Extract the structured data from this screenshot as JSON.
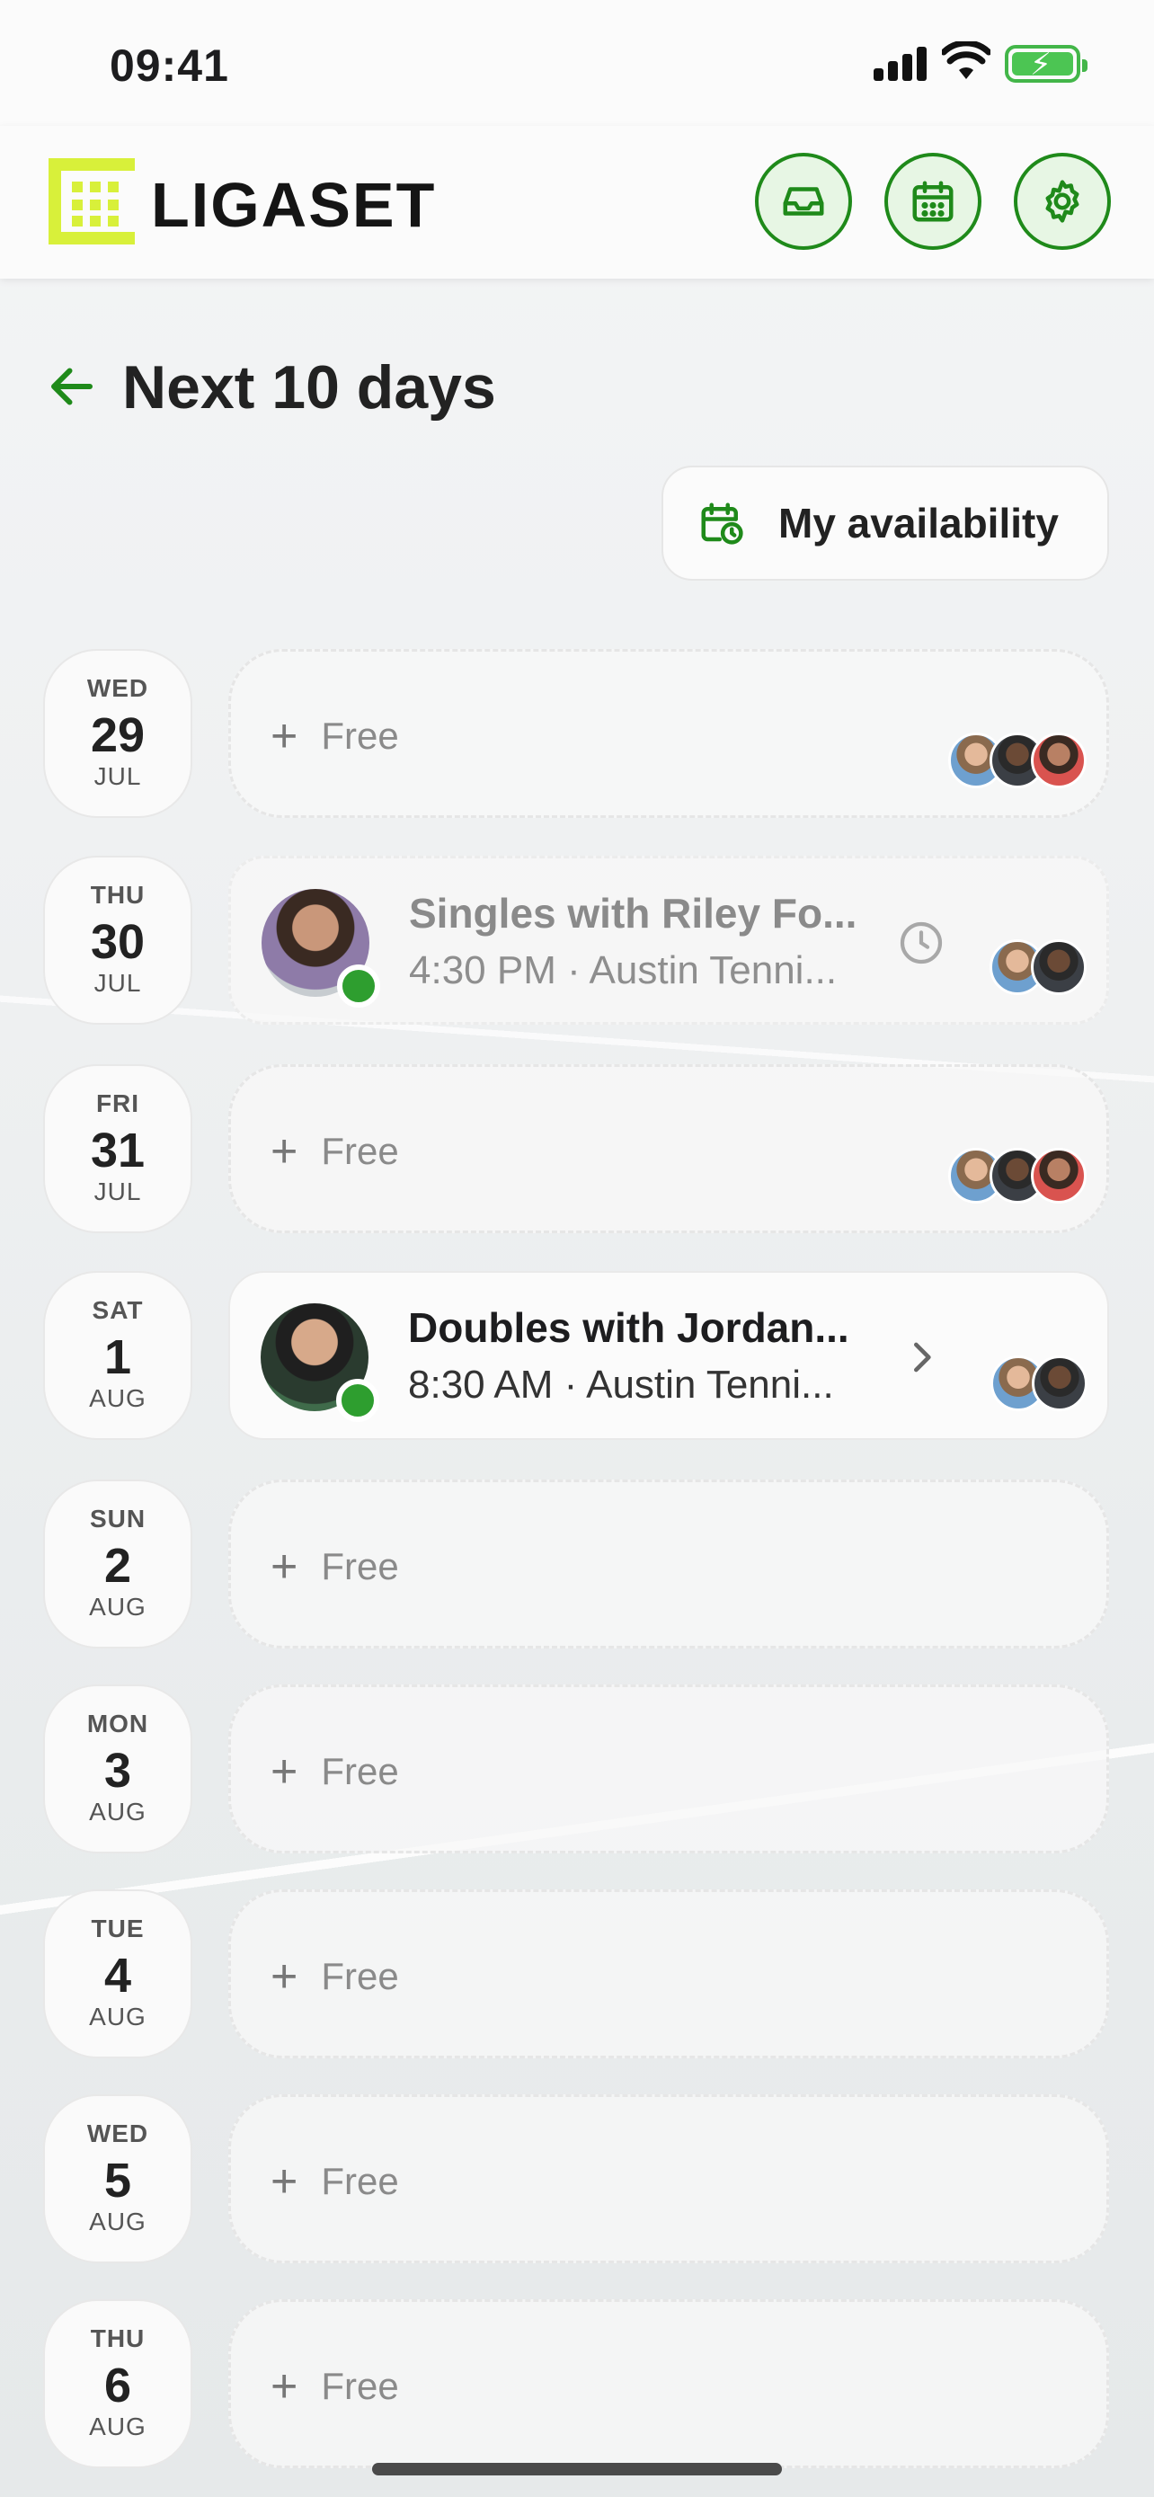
{
  "status_bar": {
    "time": "09:41"
  },
  "header": {
    "brand": "LIGASET"
  },
  "page": {
    "title": "Next 10 days",
    "availability_label": "My availability"
  },
  "days": [
    {
      "dow": "WED",
      "day": "29",
      "month": "JUL",
      "slot": "Free"
    },
    {
      "dow": "THU",
      "day": "30",
      "month": "JUL",
      "match_title": "Singles with Riley Fo...",
      "match_sub": "4:30 PM · Austin Tenni..."
    },
    {
      "dow": "FRI",
      "day": "31",
      "month": "JUL",
      "slot": "Free"
    },
    {
      "dow": "SAT",
      "day": "1",
      "month": "AUG",
      "match_title": "Doubles with Jordan...",
      "match_sub": "8:30 AM · Austin Tenni..."
    },
    {
      "dow": "SUN",
      "day": "2",
      "month": "AUG",
      "slot": "Free"
    },
    {
      "dow": "MON",
      "day": "3",
      "month": "AUG",
      "slot": "Free"
    },
    {
      "dow": "TUE",
      "day": "4",
      "month": "AUG",
      "slot": "Free"
    },
    {
      "dow": "WED",
      "day": "5",
      "month": "AUG",
      "slot": "Free"
    },
    {
      "dow": "THU",
      "day": "6",
      "month": "AUG",
      "slot": "Free"
    }
  ],
  "colors": {
    "accent_green": "#1f8a1a",
    "logo_lime": "#d8f03a",
    "free_text": "#8a8a8a"
  }
}
